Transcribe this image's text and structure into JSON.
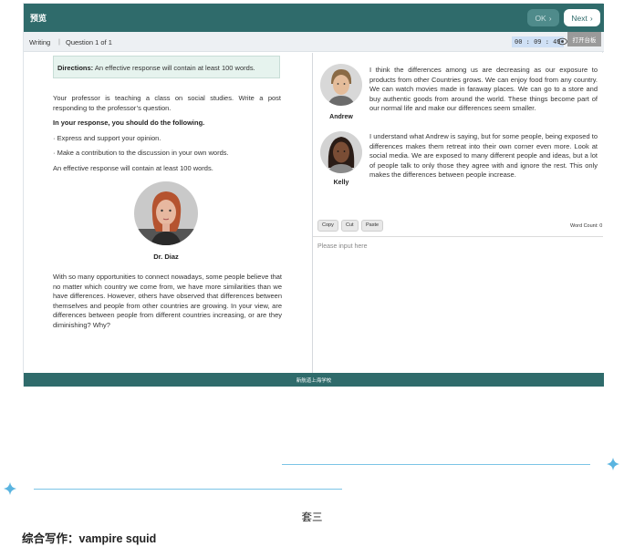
{
  "app": {
    "title": "预览",
    "ok_label": "OK",
    "next_label": "Next",
    "section": "Writing",
    "separator": "|",
    "question": "Question 1 of 1",
    "timer": "00 : 09 : 49",
    "open_panel": "打开台板",
    "footer": "新航道上海学校",
    "colors": {
      "header": "#2f6b6b",
      "directions_bg": "#e6f3ee"
    }
  },
  "left": {
    "directions_label": "Directions:",
    "directions_text": " An effective response will contain at least 100 words.",
    "prompt": "Your professor is teaching a class on social studies. Write a post responding to the professor’s question.",
    "instruction": "In your response, you should do the following.",
    "bullets": [
      "· Express and support your opinion.",
      "· Make a contribution to the discussion in your own words."
    ],
    "effective": "An effective response will contain at least 100 words.",
    "professor_name": "Dr. Diaz",
    "professor_text": "With so many opportunities to connect nowadays, some people believe that no matter which country we come from, we have more similarities than we have differences. However, others have observed that differences between themselves and people from other countries are growing. In your view, are differences between people from different countries increasing, or are they diminishing? Why?"
  },
  "right": {
    "students": [
      {
        "name": "Andrew",
        "text": "I think the differences among us are decreasing as our exposure to products from other Countries grows. We can enjoy food from any country. We can watch movies made in faraway places. We can go to a store and buy authentic goods from around the world. These things become part of our normal life and make our differences seem smaller."
      },
      {
        "name": "Kelly",
        "text": "I understand what Andrew is saying, but for some people, being exposed to differences makes them retreat into their own corner even more. Look at social media. We are exposed to many different people and ideas, but a lot of people talk to only those they agree with and ignore the rest. This only makes the differences between people increase."
      }
    ],
    "tools": [
      "Copy",
      "Cut",
      "Paste"
    ],
    "word_count": "Word Count: 0",
    "placeholder": "Please input here"
  },
  "caption": {
    "set_label": "套三",
    "essay_title": "综合写作：vampire squid"
  }
}
